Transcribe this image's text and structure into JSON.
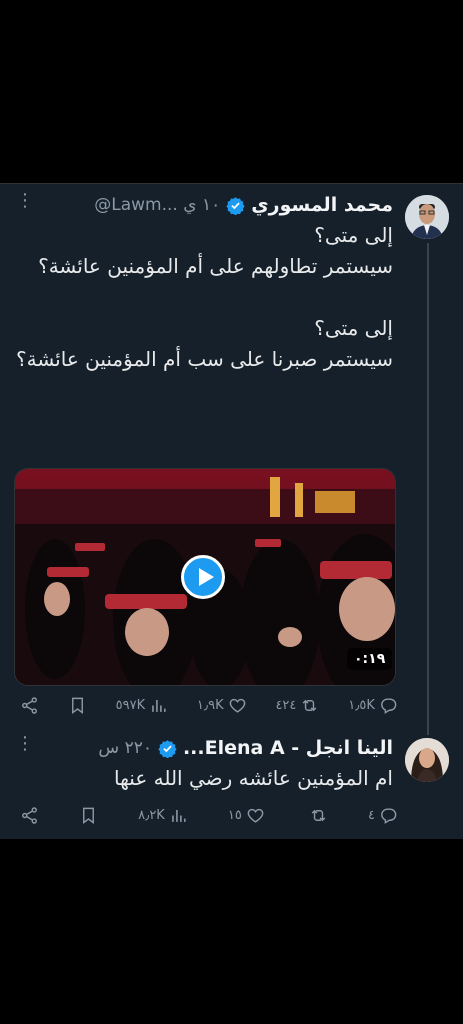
{
  "tweet1": {
    "author_name": "محمد المسوري",
    "handle_time": "@Lawm... ١٠ ي",
    "text": "إلى متى؟\nسيستمر تطاولهم على أم المؤمنين عائشة؟\n\nإلى متى؟\nسيستمر صبرنا على سب أم المؤمنين عائشة؟",
    "video_duration": "٠:١٩",
    "actions": {
      "replies": "١٫٥K",
      "retweets": "٤٢٤",
      "likes": "١٫٩K",
      "views": "٥٩٧K"
    }
  },
  "tweet2": {
    "author_name": "الينا انجل - Elena A...",
    "handle_time": "٢٢٠ س",
    "text": "ام المؤمنين عائشه رضي الله عنها",
    "actions": {
      "replies": "٤",
      "retweets": "",
      "likes": "١٥",
      "views": "٨٫٢K"
    }
  },
  "colors": {
    "background": "#15202b",
    "verified": "#1d9bf0",
    "muted": "#8b98a5"
  },
  "icons": [
    "more-icon",
    "verified-icon",
    "reply-icon",
    "retweet-icon",
    "like-icon",
    "views-icon",
    "bookmark-icon",
    "share-icon",
    "play-icon"
  ]
}
